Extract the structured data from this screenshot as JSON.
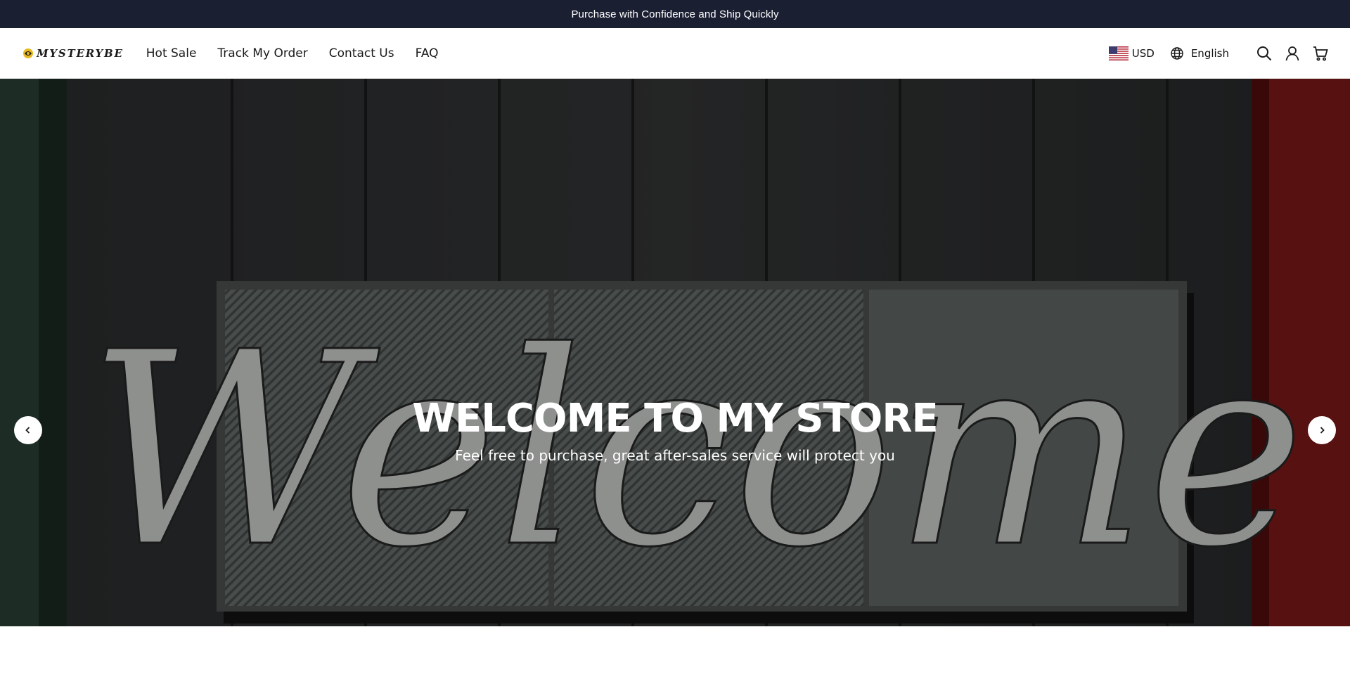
{
  "announcement": {
    "text": "Purchase with Confidence and Ship Quickly"
  },
  "header": {
    "logo_text": "MYSTERYBE",
    "nav": [
      {
        "label": "Hot Sale"
      },
      {
        "label": "Track My Order"
      },
      {
        "label": "Contact Us"
      },
      {
        "label": "FAQ"
      }
    ],
    "currency": "USD",
    "language": "English",
    "icons": [
      "globe-icon",
      "search-icon",
      "account-icon",
      "cart-icon"
    ]
  },
  "hero": {
    "title": "WELCOME TO MY STORE",
    "subtitle": "Feel free to purchase, great after-sales service will protect you",
    "sign_word": "Welcome"
  },
  "colors": {
    "announcement_bg": "#1b1f32",
    "logo_accent": "#e8b820",
    "hero_wall": "#2a2b2c",
    "sign_panel": "#6c7372",
    "sign_letters": "#e6e8e6",
    "red_post": "#8f1c1c"
  }
}
